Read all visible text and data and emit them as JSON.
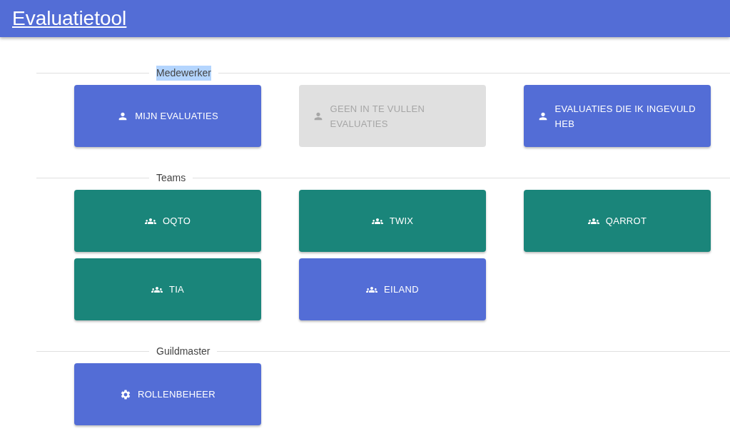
{
  "header": {
    "title": "Evaluatietool"
  },
  "sections": [
    {
      "title": "Medewerker",
      "highlighted": true,
      "buttons": [
        {
          "label": "MIJN EVALUATIES",
          "kind": "person",
          "disabled": false,
          "color": "#536dd6"
        },
        {
          "label": "GEEN IN TE VULLEN EVALUATIES",
          "kind": "person",
          "disabled": true,
          "color": "#e0e0e0"
        },
        {
          "label": "EVALUATIES DIE IK INGEVULD HEB",
          "kind": "person",
          "disabled": false,
          "color": "#536dd6"
        }
      ]
    },
    {
      "title": "Teams",
      "highlighted": false,
      "buttons": [
        {
          "label": "OQTO",
          "kind": "group",
          "disabled": false,
          "color": "#1a857a"
        },
        {
          "label": "TWIX",
          "kind": "group",
          "disabled": false,
          "color": "#1a857a"
        },
        {
          "label": "QARROT",
          "kind": "group",
          "disabled": false,
          "color": "#1a857a"
        },
        {
          "label": "TIA",
          "kind": "group",
          "disabled": false,
          "color": "#1a857a"
        },
        {
          "label": "EILAND",
          "kind": "group",
          "disabled": false,
          "color": "#536dd6"
        }
      ]
    },
    {
      "title": "Guildmaster",
      "highlighted": false,
      "buttons": [
        {
          "label": "ROLLENBEHEER",
          "kind": "gear",
          "disabled": false,
          "color": "#536dd6"
        }
      ]
    }
  ]
}
